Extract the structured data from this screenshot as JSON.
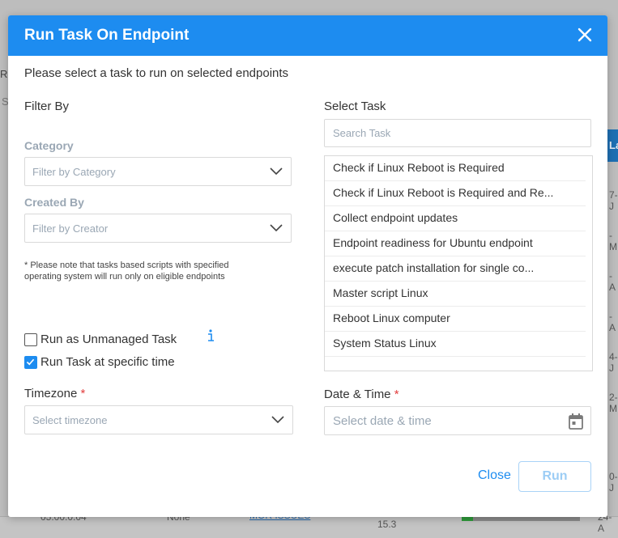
{
  "background": {
    "header_partial": "La",
    "left_text": "Re",
    "left_text2": "S",
    "row_fragments": [
      "7-J",
      "-M",
      "-A",
      "-A",
      "4-J",
      "2-M",
      "0-J"
    ],
    "bottom_row": {
      "ip": "05.00.0.04",
      "none": "None",
      "link": "MOR ISSUES",
      "value": "15.3",
      "date": "24-A"
    }
  },
  "modal": {
    "title": "Run Task On Endpoint",
    "subtitle": "Please select a task to run on selected endpoints",
    "filter_by_label": "Filter By",
    "category_label": "Category",
    "category_placeholder": "Filter by Category",
    "created_by_label": "Created By",
    "created_by_placeholder": "Filter by Creator",
    "note": "* Please note that tasks based scripts with specified operating system will run only on eligible endpoints",
    "run_unmanaged_label": "Run as Unmanaged Task",
    "run_unmanaged_checked": false,
    "run_specific_time_label": "Run Task at specific time",
    "run_specific_time_checked": true,
    "timezone_label": "Timezone",
    "timezone_placeholder": "Select timezone",
    "select_task_label": "Select Task",
    "search_placeholder": "Search Task",
    "tasks": [
      "Check if Linux Reboot is Required",
      "Check if Linux Reboot is Required and Re...",
      "Collect endpoint updates",
      "Endpoint readiness for Ubuntu endpoint",
      "execute patch installation for single co...",
      "Master script Linux",
      "Reboot Linux computer",
      "System Status Linux"
    ],
    "datetime_label": "Date & Time",
    "datetime_placeholder": "Select date & time",
    "required_mark": "*",
    "close_label": "Close",
    "run_label": "Run"
  },
  "colors": {
    "primary": "#1d8cf0",
    "required": "#e23d3d"
  }
}
